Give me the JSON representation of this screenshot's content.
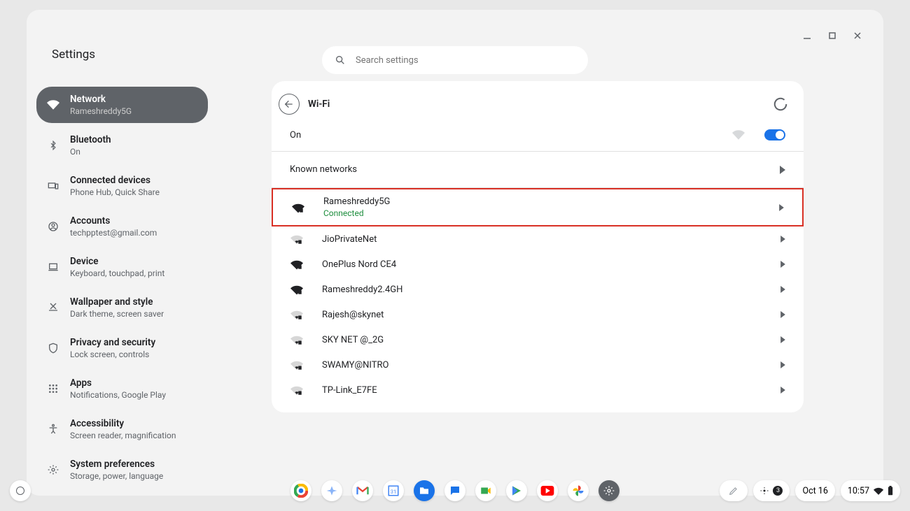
{
  "title": "Settings",
  "search": {
    "placeholder": "Search settings"
  },
  "sidebar": {
    "items": [
      {
        "label": "Network",
        "sub": "Rameshreddy5G"
      },
      {
        "label": "Bluetooth",
        "sub": "On"
      },
      {
        "label": "Connected devices",
        "sub": "Phone Hub, Quick Share"
      },
      {
        "label": "Accounts",
        "sub": "techpptest@gmail.com"
      },
      {
        "label": "Device",
        "sub": "Keyboard, touchpad, print"
      },
      {
        "label": "Wallpaper and style",
        "sub": "Dark theme, screen saver"
      },
      {
        "label": "Privacy and security",
        "sub": "Lock screen, controls"
      },
      {
        "label": "Apps",
        "sub": "Notifications, Google Play"
      },
      {
        "label": "Accessibility",
        "sub": "Screen reader, magnification"
      },
      {
        "label": "System preferences",
        "sub": "Storage, power, language"
      }
    ]
  },
  "panel": {
    "title": "Wi-Fi",
    "on_label": "On",
    "known_label": "Known networks",
    "networks": [
      {
        "name": "Rameshreddy5G",
        "status": "Connected",
        "strength": "full",
        "highlight": true
      },
      {
        "name": "JioPrivateNet",
        "status": "",
        "strength": "low",
        "highlight": false
      },
      {
        "name": "OnePlus Nord CE4",
        "status": "",
        "strength": "full",
        "highlight": false
      },
      {
        "name": "Rameshreddy2.4GH",
        "status": "",
        "strength": "full",
        "highlight": false
      },
      {
        "name": "Rajesh@skynet",
        "status": "",
        "strength": "low",
        "highlight": false
      },
      {
        "name": "SKY NET @_2G",
        "status": "",
        "strength": "low",
        "highlight": false
      },
      {
        "name": "SWAMY@NITRO",
        "status": "",
        "strength": "low",
        "highlight": false
      },
      {
        "name": "TP-Link_E7FE",
        "status": "",
        "strength": "low",
        "highlight": false
      }
    ]
  },
  "tray": {
    "badge_count": "3",
    "date": "Oct 16",
    "time": "10:57"
  }
}
